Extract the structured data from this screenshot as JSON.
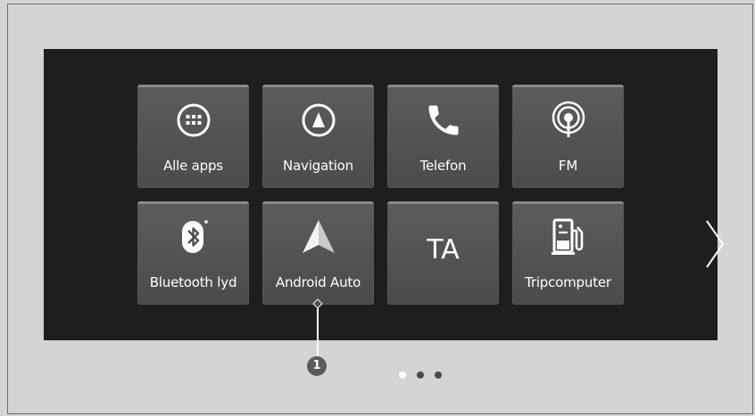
{
  "tiles": [
    {
      "label": "Alle apps",
      "icon": "apps-grid-icon"
    },
    {
      "label": "Navigation",
      "icon": "navigation-compass-icon"
    },
    {
      "label": "Telefon",
      "icon": "phone-icon"
    },
    {
      "label": "FM",
      "icon": "radio-antenna-icon"
    },
    {
      "label": "Bluetooth lyd",
      "icon": "bluetooth-icon"
    },
    {
      "label": "Android Auto",
      "icon": "android-auto-icon"
    },
    {
      "label": "TA",
      "icon": "traffic-announcement-text"
    },
    {
      "label": "Tripcomputer",
      "icon": "fuel-pump-icon"
    }
  ],
  "pagination": {
    "total": 3,
    "active": 1
  },
  "next_page_icon": "chevron-right-icon",
  "callout": {
    "number": "1"
  },
  "colors": {
    "screen": "#1e1e1e",
    "tile": "#555555",
    "page_bg": "#d4d4d4"
  }
}
